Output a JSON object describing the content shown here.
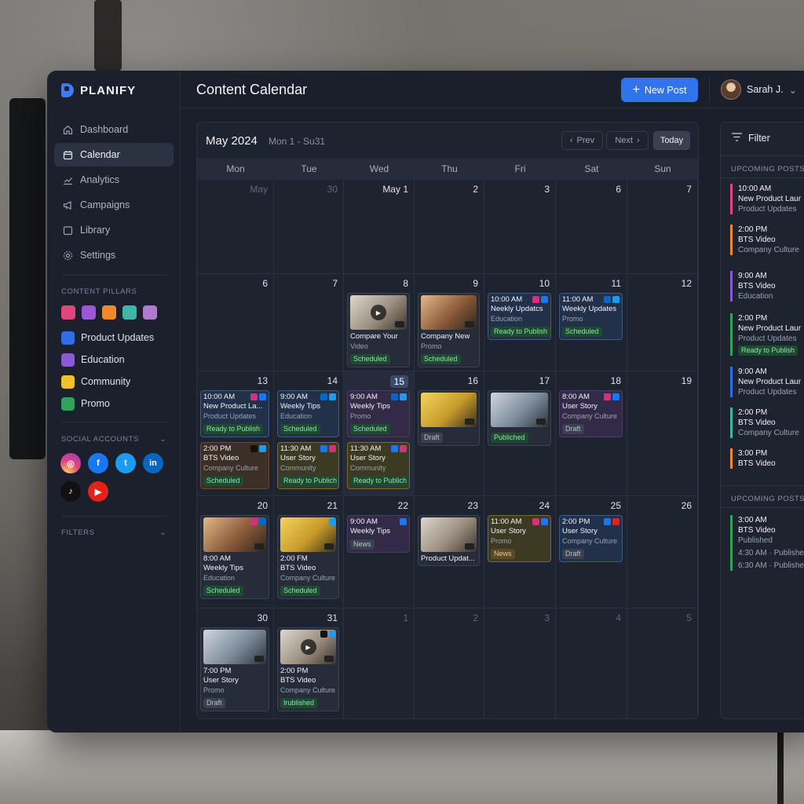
{
  "app": {
    "name": "PLANIFY",
    "title": "Content Calendar"
  },
  "header": {
    "new_post_label": "New Post",
    "user_name": "Sarah J."
  },
  "sidebar": {
    "nav": [
      {
        "label": "Dashboard",
        "icon": "home-icon"
      },
      {
        "label": "Calendar",
        "icon": "calendar-icon",
        "active": true
      },
      {
        "label": "Analytics",
        "icon": "chart-icon"
      },
      {
        "label": "Campaigns",
        "icon": "megaphone-icon"
      },
      {
        "label": "Library",
        "icon": "folder-icon"
      },
      {
        "label": "Settings",
        "icon": "gear-icon"
      }
    ],
    "pillars_title": "CONTENT PILLARS",
    "swatch_colors": [
      "#e0457b",
      "#9b57d6",
      "#ee8a2c",
      "#3fb6a8",
      "#b07ad0"
    ],
    "pillars": [
      {
        "label": "Product Updates",
        "color": "#2f6fe4"
      },
      {
        "label": "Education",
        "color": "#8a5ad6"
      },
      {
        "label": "Community",
        "color": "#f0c02e"
      },
      {
        "label": "Promo",
        "color": "#2fa35c"
      }
    ],
    "social_title": "SOCIAL ACCOUNTS",
    "socials": [
      {
        "name": "instagram",
        "glyph": "◎",
        "color": "#d6307c"
      },
      {
        "name": "facebook",
        "glyph": "f",
        "color": "#1877f2"
      },
      {
        "name": "twitter",
        "glyph": "t",
        "color": "#1d9bf0"
      },
      {
        "name": "linkedin",
        "glyph": "in",
        "color": "#0a66c2"
      },
      {
        "name": "tiktok",
        "glyph": "♪",
        "color": "#111111"
      },
      {
        "name": "youtube",
        "glyph": "▶",
        "color": "#e62117"
      }
    ],
    "filters_title": "FILTERS"
  },
  "calendar": {
    "month": "May 2024",
    "range": "Mon 1 - Su31",
    "prev_label": "Prev",
    "next_label": "Next",
    "today_label": "Today",
    "weekdays": [
      "Mon",
      "Tue",
      "Wed",
      "Thu",
      "Fri",
      "Sat",
      "Sun"
    ],
    "weeks": [
      [
        "May",
        "30",
        "May 1",
        "2",
        "3",
        "6",
        "7"
      ],
      [
        "6",
        "7",
        "8",
        "9",
        "10",
        "11",
        "12"
      ],
      [
        "13",
        "14",
        "15",
        "16",
        "17",
        "18",
        "19"
      ],
      [
        "20",
        "21",
        "22",
        "23",
        "24",
        "25",
        "26"
      ],
      [
        "30",
        "31",
        "1",
        "2",
        "3",
        "4",
        "5"
      ]
    ],
    "today": "15",
    "posts": [
      {
        "week": 1,
        "day": 2,
        "thumb": true,
        "play": true,
        "title": "Compare Your",
        "sub": "Video",
        "status": "Scheduled",
        "st": "green"
      },
      {
        "week": 1,
        "day": 3,
        "thumb": true,
        "title": "Company New",
        "sub": "Promo",
        "status": "Scheduled",
        "st": "green"
      },
      {
        "week": 1,
        "day": 4,
        "time": "10:00 AM",
        "title": "Neekly Updatcs",
        "sub": "Education",
        "status": "Ready to Publish",
        "st": "green",
        "plats": [
          "#d6307c",
          "#1877f2"
        ],
        "style": "blue"
      },
      {
        "week": 1,
        "day": 5,
        "time": "11:00 AM",
        "title": "Weekly Updates",
        "sub": "Promo",
        "status": "Scheduled",
        "st": "green",
        "plats": [
          "#0a66c2",
          "#1d9bf0"
        ],
        "style": "blue"
      },
      {
        "week": 2,
        "day": 0,
        "time": "10:00 AM",
        "title": "New Product La...",
        "sub": "Product Updates",
        "status": "Ready to Publish",
        "st": "green",
        "plats": [
          "#d6307c",
          "#1877f2"
        ],
        "style": "blue"
      },
      {
        "week": 2,
        "day": 0,
        "slot": 2,
        "time": "2:00 PM",
        "title": "BTS Video",
        "sub": "Company Culture",
        "status": "Scheduled",
        "st": "green",
        "plats": [
          "#111111",
          "#1d9bf0"
        ],
        "style": "brown"
      },
      {
        "week": 2,
        "day": 1,
        "time": "9:00 AM",
        "title": "Weekly Tips",
        "sub": "Education",
        "status": "Scheduled",
        "st": "green",
        "plats": [
          "#0a66c2",
          "#1d9bf0"
        ],
        "style": "blue"
      },
      {
        "week": 2,
        "day": 1,
        "slot": 2,
        "time": "11:30 AM",
        "title": "User Story",
        "sub": "Community",
        "status": "Ready to Publich",
        "st": "green",
        "plats": [
          "#1877f2",
          "#d6307c"
        ],
        "style": "olive"
      },
      {
        "week": 2,
        "day": 2,
        "time": "9:00 AM",
        "title": "Weekly Tips",
        "sub": "Promo",
        "status": "Scheduled",
        "st": "green",
        "plats": [
          "#0a66c2",
          "#1d9bf0"
        ],
        "style": "purple"
      },
      {
        "week": 2,
        "day": 2,
        "slot": 2,
        "time": "11:30 AM",
        "title": "User Story",
        "sub": "Community",
        "status": "Ready to Publich",
        "st": "green",
        "plats": [
          "#1877f2",
          "#d6307c"
        ],
        "style": "olive"
      },
      {
        "week": 2,
        "day": 3,
        "thumb": true,
        "status": "Draft",
        "st": "gray"
      },
      {
        "week": 2,
        "day": 4,
        "thumb": true,
        "status": "Publiched",
        "st": "green"
      },
      {
        "week": 2,
        "day": 5,
        "time": "8:00 AM",
        "title": "User Story",
        "sub": "Company Culture",
        "status": "Draft",
        "st": "gray",
        "plats": [
          "#d6307c",
          "#1877f2"
        ],
        "style": "purple"
      },
      {
        "week": 3,
        "day": 0,
        "thumb": true,
        "time": "8:00 AM",
        "title": "Weekly Tips",
        "sub": "Education",
        "status": "Scheduled",
        "st": "green",
        "plats": [
          "#d6307c",
          "#0a66c2"
        ]
      },
      {
        "week": 3,
        "day": 1,
        "thumb": true,
        "time": "2:00 FM",
        "title": "BTS Video",
        "sub": "Company Culture",
        "status": "Scheduled",
        "st": "green",
        "plats": [
          "#1d9bf0"
        ]
      },
      {
        "week": 3,
        "day": 2,
        "time": "9:00 AM",
        "title": "Weekly Tips",
        "status": "News",
        "st": "gray",
        "plats": [
          "#1877f2"
        ],
        "style": "purple"
      },
      {
        "week": 3,
        "day": 3,
        "thumb": true,
        "title": "Product Updat..."
      },
      {
        "week": 3,
        "day": 4,
        "time": "11:00 AM",
        "title": "User Story",
        "sub": "Promo",
        "status": "News",
        "st": "brown",
        "plats": [
          "#d6307c",
          "#1877f2"
        ],
        "style": "olive"
      },
      {
        "week": 3,
        "day": 5,
        "time": "2:00 PM",
        "title": "User Story",
        "sub": "Company Culture",
        "status": "Draft",
        "st": "gray",
        "plats": [
          "#1877f2",
          "#e62117"
        ],
        "style": "blue"
      },
      {
        "week": 4,
        "day": 0,
        "thumb": true,
        "time": "7:00 PM",
        "title": "User Story",
        "sub": "Promo",
        "status": "Draft",
        "st": "gray"
      },
      {
        "week": 4,
        "day": 1,
        "thumb": true,
        "play": true,
        "time": "2:00 PM",
        "title": "BTS Video",
        "sub": "Company Culture",
        "status": "Irublished",
        "st": "green",
        "plats": [
          "#111111",
          "#1d9bf0"
        ]
      }
    ]
  },
  "right_panel": {
    "filter_label": "Filter",
    "upcoming_title": "UPCOMING POSTS",
    "upcoming": [
      {
        "time": "10:00 AM",
        "title": "New Product Laur",
        "cat": "Product Updates",
        "color": "#e0457b"
      },
      {
        "time": "2:00 PM",
        "title": "BTS Video",
        "cat": "Company Culture",
        "color": "#ee8a2c"
      },
      {
        "time": "9:00 AM",
        "title": "BTS Video",
        "cat": "Education",
        "color": "#8a5ad6"
      },
      {
        "time": "2:00 PM",
        "title": "New Product Laur",
        "cat": "Product Updates",
        "status": "Ready to Publish",
        "color": "#2fa35c"
      },
      {
        "time": "9:00 AM",
        "title": "New Product Laur",
        "cat": "Product Updates",
        "color": "#2f6fe4"
      },
      {
        "time": "2:00 PM",
        "title": "BTS Video",
        "cat": "Company Culture",
        "color": "#3fb6a8"
      },
      {
        "time": "3:00 PM",
        "title": "BTS Video",
        "cat": "",
        "color": "#ee8a2c"
      }
    ],
    "upcoming_title_2": "UPCOMING POSTS",
    "published": {
      "time": "3:00 AM",
      "title": "BTS Video",
      "cat": "Published",
      "rows": [
        "4:30 AM · Publishe",
        "6:30 AM · Publishe"
      ],
      "color": "#2fa35c"
    }
  }
}
